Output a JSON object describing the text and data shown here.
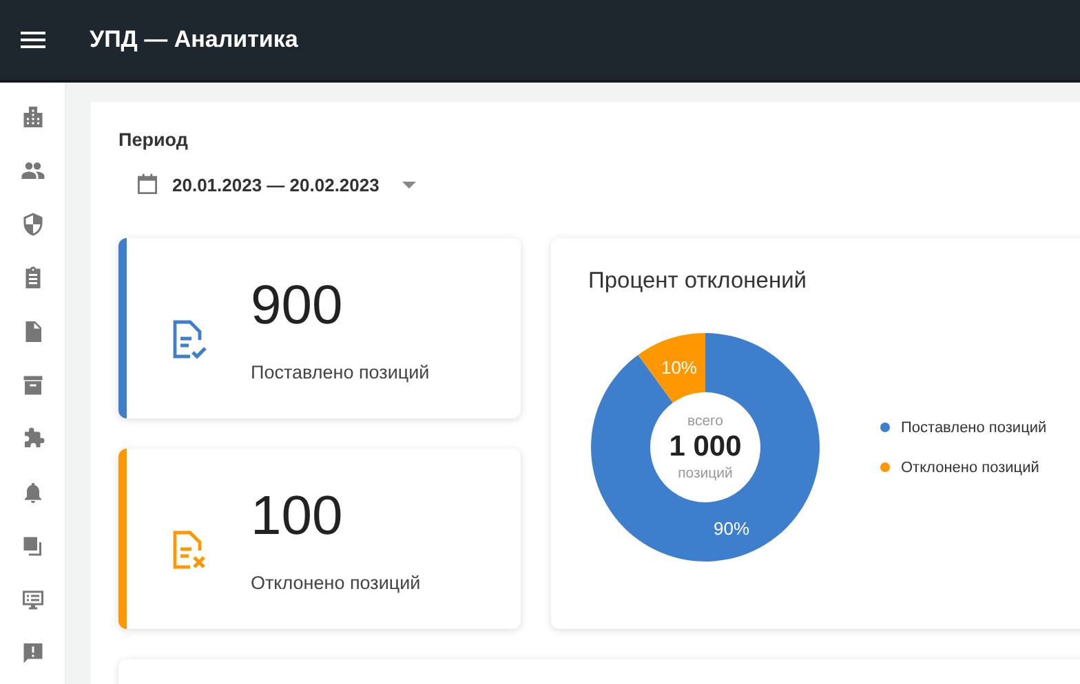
{
  "header": {
    "title": "УПД — Аналитика"
  },
  "period": {
    "label": "Период",
    "value": "20.01.2023 — 20.02.2023"
  },
  "stats": [
    {
      "kind": "accepted",
      "color": "#3d7fcc",
      "value": "900",
      "label": "Поставлено позиций"
    },
    {
      "kind": "rejected",
      "color": "#ff9800",
      "value": "100",
      "label": "Отклонено позиций"
    }
  ],
  "chart_card": {
    "center": {
      "caption_top": "всего",
      "total": "1 000",
      "caption_bottom": "позиций"
    },
    "chart_data": {
      "type": "donut",
      "title": "Процент отклонений",
      "legend": "right",
      "categories": [
        "Поставлено позиций",
        "Отклонено позиций"
      ],
      "series": [
        {
          "values": [
            90,
            10
          ]
        }
      ],
      "colors": [
        "#3d7fcc",
        "#ff9800"
      ],
      "value_labels": [
        "90%",
        "10%"
      ]
    }
  }
}
